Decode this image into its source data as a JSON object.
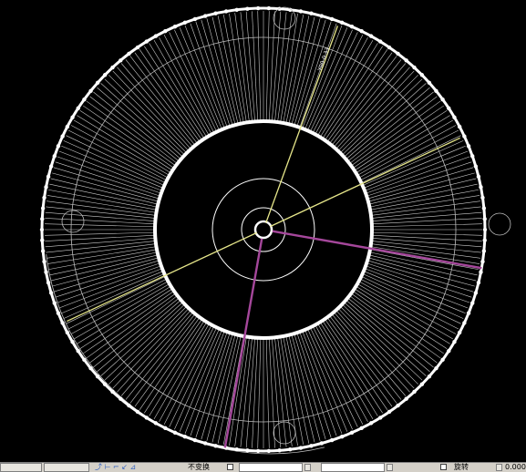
{
  "canvas": {
    "background": "#000000",
    "colors": {
      "outline": "#ffffff",
      "spokes": "#f0f0f0",
      "guide": "#bdbdbd",
      "yellow_line": "#e6e68a",
      "magenta_line": "#a5479b"
    },
    "spoke_count": 240,
    "outer_bead_count": 130,
    "yellow_line_angles_deg": [
      -70,
      -25,
      155
    ],
    "magenta_line_angles_deg": [
      10,
      100
    ],
    "inner_label": "Υ00-0.33"
  },
  "statusbar": {
    "label_1": "不变换",
    "label_2": "旋转",
    "value_right": "0.000",
    "icon_names": [
      "toolbar-button-icon",
      "toolbar-button-icon",
      "axis-icon",
      "checkbox-icon",
      "spin-icon",
      "spin-icon"
    ]
  }
}
